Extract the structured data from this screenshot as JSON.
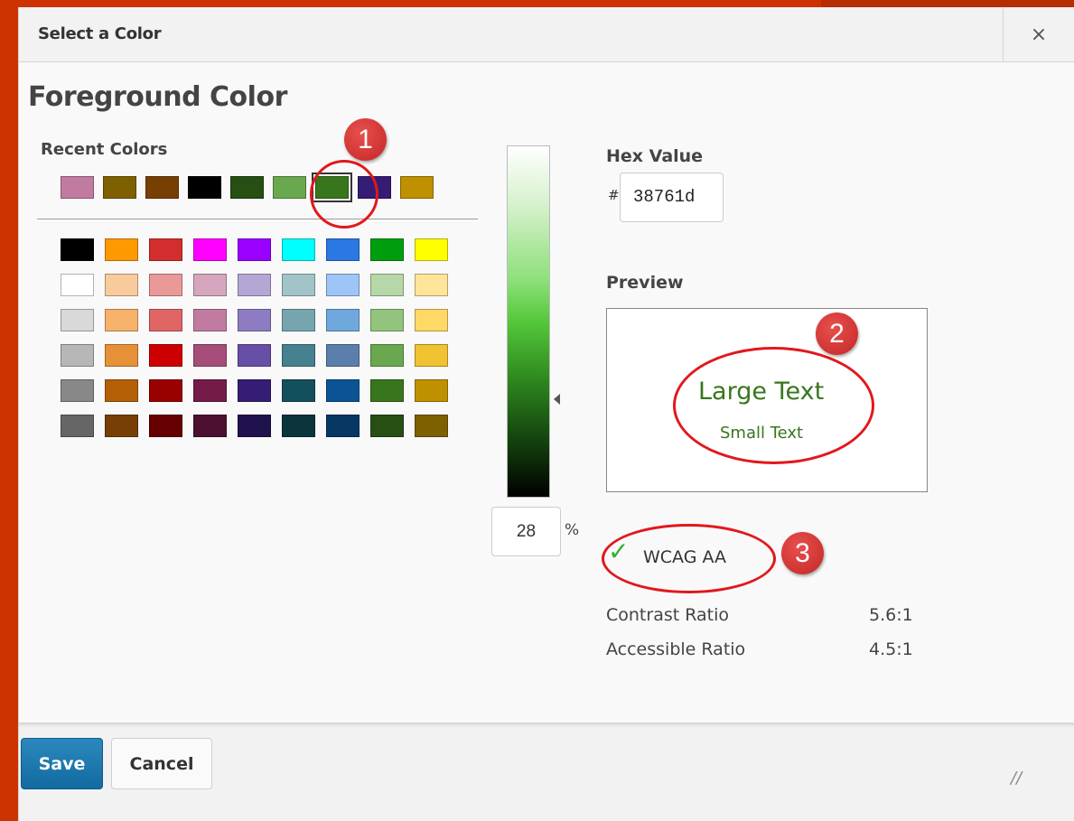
{
  "dialog": {
    "title": "Select a Color",
    "close_glyph": "×"
  },
  "main": {
    "heading": "Foreground Color",
    "recent_label": "Recent Colors",
    "recent_colors": [
      "#c27ba0",
      "#7f6000",
      "#783f04",
      "#000000",
      "#274e13",
      "#6aa84f",
      "#38761d",
      "#351c75",
      "#bf9000"
    ],
    "selected_recent": "#38761d",
    "palette": [
      [
        "#000000",
        "#ff9900",
        "#d22e2e",
        "#ff00ff",
        "#9900ff",
        "#00ffff",
        "#2b78e4",
        "#009e0f",
        "#ffff00"
      ],
      [
        "#ffffff",
        "#f9cb9c",
        "#ea9999",
        "#d5a6bd",
        "#b4a7d6",
        "#a2c4c9",
        "#9fc5f8",
        "#b6d7a8",
        "#ffe599"
      ],
      [
        "#d9d9d9",
        "#f6b26b",
        "#e06666",
        "#c27ba0",
        "#8e7cc3",
        "#76a5af",
        "#6fa8dc",
        "#93c47d",
        "#ffd966"
      ],
      [
        "#b7b7b7",
        "#e69138",
        "#cc0000",
        "#a64d79",
        "#674ea7",
        "#45818e",
        "#5b7fad",
        "#6aa84f",
        "#f1c232"
      ],
      [
        "#888888",
        "#b45f06",
        "#990000",
        "#741b47",
        "#351c75",
        "#134f5c",
        "#0b5394",
        "#38761d",
        "#bf9000"
      ],
      [
        "#666666",
        "#783f04",
        "#660000",
        "#4c1130",
        "#20124d",
        "#0c343d",
        "#073763",
        "#274e13",
        "#7f6000"
      ]
    ],
    "lightness_value": "28",
    "percent_sign": "%"
  },
  "hex": {
    "label": "Hex Value",
    "hash": "#",
    "value": "38761d"
  },
  "preview": {
    "label": "Preview",
    "large_text": "Large Text",
    "small_text": "Small Text",
    "text_color": "#38761d"
  },
  "accessibility": {
    "check_glyph": "✓",
    "wcag_label": "WCAG AA",
    "contrast_ratio_label": "Contrast Ratio",
    "contrast_ratio_value": "5.6:1",
    "accessible_ratio_label": "Accessible Ratio",
    "accessible_ratio_value": "4.5:1"
  },
  "footer": {
    "save_label": "Save",
    "cancel_label": "Cancel",
    "resize_glyph": "//"
  },
  "annotations": {
    "badge_1": "1",
    "badge_2": "2",
    "badge_3": "3"
  }
}
